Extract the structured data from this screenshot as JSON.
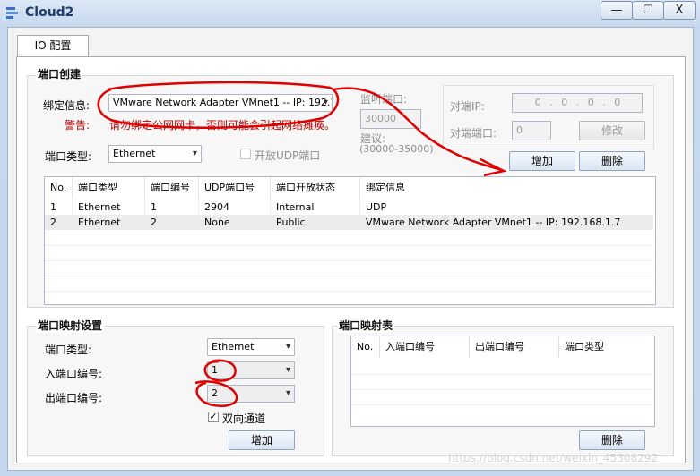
{
  "window": {
    "title": "Cloud2",
    "controls": {
      "minimize": "—",
      "maximize": "☐",
      "close": "X"
    }
  },
  "tabs": [
    {
      "label": "IO 配置"
    }
  ],
  "port_create": {
    "title": "端口创建",
    "bind_label": "绑定信息:",
    "bind_value": "VMware Network Adapter VMnet1 -- IP: 192.16",
    "warning_label": "警告:",
    "warning_text": "请勿绑定公网网卡，否则可能会引起网络瘫痪。",
    "port_type_label": "端口类型:",
    "port_type_value": "Ethernet",
    "udp_open_label": "开放UDP端口",
    "listen_label": "监听端口:",
    "listen_value": "30000",
    "suggest_label": "建议:",
    "suggest_range": "(30000-35000)",
    "peer_ip_label": "对端IP:",
    "peer_ip_value": "0 . 0 . 0 . 0",
    "peer_port_label": "对端端口:",
    "peer_port_value": "0",
    "modify_button": "修改",
    "add_button": "增加",
    "delete_button": "删除",
    "table": {
      "headers": [
        "No.",
        "端口类型",
        "端口编号",
        "UDP端口号",
        "端口开放状态",
        "绑定信息"
      ],
      "rows": [
        [
          "1",
          "Ethernet",
          "1",
          "2904",
          "Internal",
          "UDP"
        ],
        [
          "2",
          "Ethernet",
          "2",
          "None",
          "Public",
          "VMware Network Adapter VMnet1 -- IP: 192.168.1.7"
        ]
      ]
    }
  },
  "port_mapping_settings": {
    "title": "端口映射设置",
    "port_type_label": "端口类型:",
    "port_type_value": "Ethernet",
    "in_port_label": "入端口编号:",
    "in_port_value": "1",
    "out_port_label": "出端口编号:",
    "out_port_value": "2",
    "bidirectional_label": "双向通道",
    "bidirectional_checked": "✓",
    "add_button": "增加"
  },
  "port_mapping_table": {
    "title": "端口映射表",
    "headers": [
      "No.",
      "入端口编号",
      "出端口编号",
      "端口类型"
    ],
    "delete_button": "删除"
  },
  "watermark": "https://blog.csdn.net/weixin_45308292",
  "annotation_color": "#e00000"
}
